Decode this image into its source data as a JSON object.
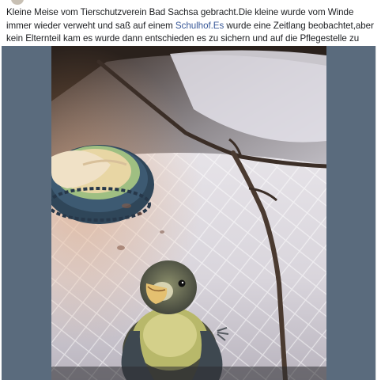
{
  "post": {
    "text_part1": "Kleine Meise vom Tierschutzverein  Bad Sachsa gebracht.Die kleine wurde vom Winde immer wieder verweht und saß auf einem ",
    "link_text": "Schulhof.Es",
    "text_part2": " wurde eine Zeitlang beobachtet,aber kein Elternteil kam es wurde  dann  entschieden es zu sichern und auf die Pflegestelle zu bringen.",
    "emoji": "green-heart-icon"
  },
  "colors": {
    "link": "#385898",
    "text": "#1c1e21",
    "media_background": "#5a6b7d",
    "heart": "#5ec232"
  }
}
